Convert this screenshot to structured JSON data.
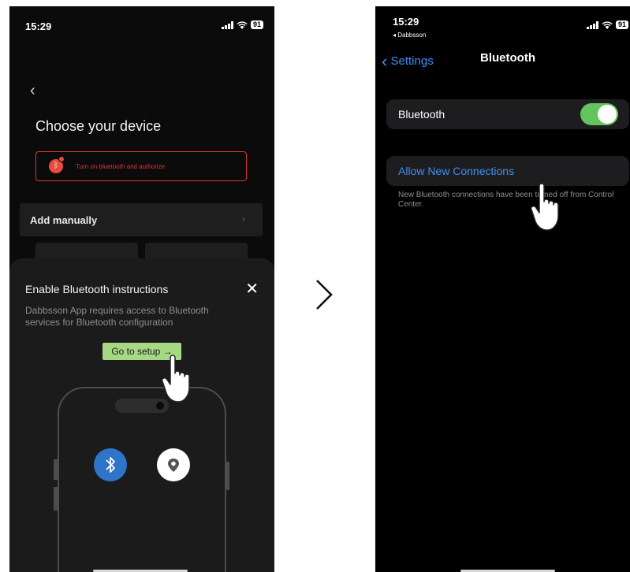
{
  "left_phone": {
    "status_bar": {
      "time": "15:29",
      "battery": "91"
    },
    "page_title": "Choose your device",
    "bluetooth_alert": "Turn on bluetooth and authorize",
    "add_manually": "Add manually",
    "sheet": {
      "title": "Enable Bluetooth instructions",
      "description": "Dabbsson App requires access to Bluetooth services for Bluetooth configuration",
      "setup_button": "Go to setup →"
    }
  },
  "right_phone": {
    "status_bar": {
      "time": "15:29",
      "back_app": "◂ Dabbsson",
      "battery": "91"
    },
    "nav": {
      "back_label": "Settings",
      "title": "Bluetooth"
    },
    "bluetooth_row": {
      "label": "Bluetooth",
      "enabled": true
    },
    "allow_row": {
      "label": "Allow New Connections"
    },
    "note_text": "New Bluetooth connections have been turned off from Control Center."
  },
  "colors": {
    "alert_red": "#d33a2f",
    "setup_green": "#a7d985",
    "ios_blue": "#3e8ff5",
    "toggle_green": "#63c45b",
    "bt_circle": "#2e74c9"
  },
  "icons": [
    "chevron-left-icon",
    "close-icon",
    "bluetooth-icon",
    "location-icon",
    "signal-icon",
    "wifi-icon",
    "battery-icon",
    "pointing-hand-icon",
    "arrow-right-icon"
  ]
}
